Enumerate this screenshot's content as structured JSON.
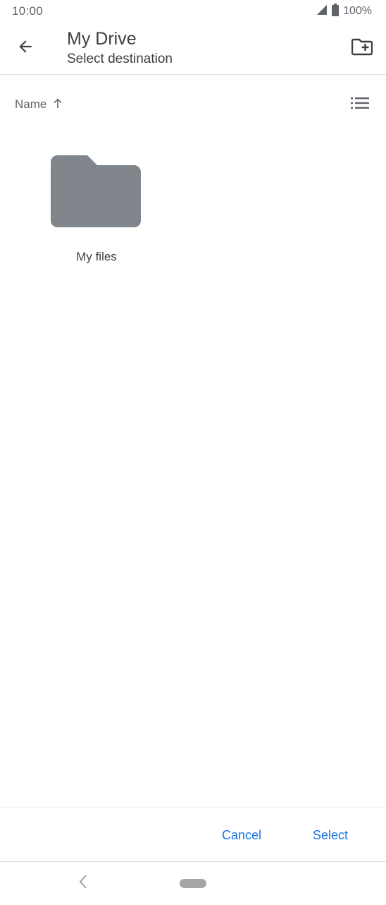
{
  "status_bar": {
    "time": "10:00",
    "battery_percent": "100%",
    "icons": [
      "signal-icon",
      "battery-icon"
    ]
  },
  "app_bar": {
    "title": "My Drive",
    "subtitle": "Select destination",
    "icons": [
      "arrow-back-icon",
      "create-folder-icon"
    ]
  },
  "sort": {
    "label": "Name",
    "direction_icon": "arrow-up-icon",
    "view_icon": "list-view-icon"
  },
  "folders": [
    {
      "name": "My files",
      "icon": "folder-icon",
      "color": "#80868b"
    }
  ],
  "actions": {
    "cancel_label": "Cancel",
    "select_label": "Select",
    "accent_color": "#1a73e8"
  },
  "nav_bar": {
    "icons": [
      "nav-back-icon",
      "home-pill"
    ]
  }
}
